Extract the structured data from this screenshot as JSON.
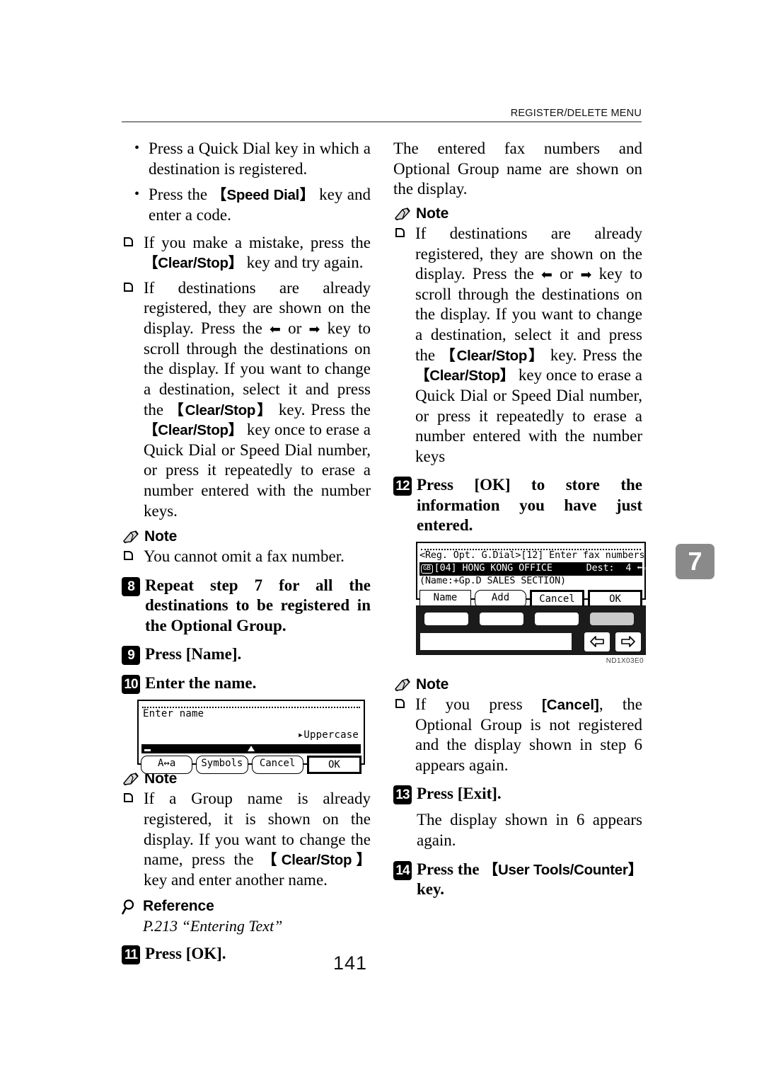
{
  "header": {
    "running_head": "REGISTER/DELETE MENU"
  },
  "left_column": {
    "bullets": [
      "Press a Quick Dial key in which a destination is regis-tered.",
      "Press the "
    ],
    "bullet1": "Press a Quick Dial key in which a destination is registered.",
    "bullet2_pre": "Press the ",
    "bullet2_key": "【Speed Dial】",
    "bullet2_post": " key and enter a code.",
    "note_a_pre": "If you make a mistake, press the ",
    "note_a_key": "【Clear/Stop】",
    "note_a_post": " key and try again.",
    "note_b_1": "If destinations are already registered, they are shown on the display. Press the ",
    "note_b_arrow_left": "⬅",
    "note_b_or": " or ",
    "note_b_arrow_right": "➡",
    "note_b_2": " key to scroll through the destinations on the display. If you want to change a destination, select it and press the ",
    "note_b_key1": "【Clear/Stop】",
    "note_b_3": " key. Press the ",
    "note_b_key2": "【Clear/Stop】",
    "note_b_4": " key once to erase a Quick Dial or Speed Dial number, or press it repeatedly to erase a number entered with the number keys.",
    "note_heading": "Note",
    "note_c": "You cannot omit a fax number.",
    "step8_num": "8",
    "step8_text": "Repeat step 7 for all the destinations to be registered in the Optional Group.",
    "step9_num": "9",
    "step9_text": "Press [Name].",
    "step10_num": "10",
    "step10_text": "Enter the name.",
    "lcd_enter_name": {
      "title": "Enter name",
      "case_mode": "▸Uppercase",
      "buttons": [
        "A↔a",
        "Symbols",
        "Cancel",
        "OK"
      ]
    },
    "note2_heading": "Note",
    "note2_1": "If a Group name is already registered, it is shown on the display. If you want to change the name, press the ",
    "note2_key": "【Clear/Stop】",
    "note2_2": " key and enter another name.",
    "reference_heading": "Reference",
    "reference_text": "P.213 “Entering Text”",
    "step11_num": "11",
    "step11_text": "Press [OK]."
  },
  "right_column": {
    "intro": "The entered fax numbers and Optional Group name are shown on the display.",
    "note_heading": "Note",
    "note_1": "If destinations are already registered, they are shown on the display. Press the ",
    "arrow_left": "⬅",
    "or_word": " or ",
    "arrow_right": "➡",
    "note_2": " key to scroll through the destinations on the display. If you want to change a destination, select it and press the ",
    "note_key1": "【Clear/",
    "note_key1b": "Stop】",
    "note_3": " key. Press the ",
    "note_key2": "【Clear/Stop】",
    "note_4": " key once to erase a Quick Dial or Speed Dial number, or press it repeatedly to erase a number entered with the number keys",
    "step12_num": "12",
    "step12_text": "Press [OK] to store the information you have just entered.",
    "lcd_reg_opt": {
      "line1": "<Reg. Opt. G.Dial>[12] Enter fax numbers",
      "line2_icon": "GB",
      "line2": "[04] HONG KONG OFFICE      Dest:  4 ",
      "line2_nav_left": "⬅",
      "line2_nav_right": "⇨",
      "line3": "(Name:+Gp.D SALES SECTION)",
      "buttons": [
        "Name",
        "Add",
        "Cancel",
        "OK"
      ]
    },
    "panel_caption": "ND1X03E0",
    "note2_heading": "Note",
    "note2_pre": "If you press ",
    "note2_key": "[Cancel]",
    "note2_post": ", the Optional Group is not registered and the display shown in step 6 appears again.",
    "step13_num": "13",
    "step13_text": "Press [Exit].",
    "step13_body": "The display shown in 6 appears again.",
    "step14_num": "14",
    "step14_pre": "Press the ",
    "step14_key": "【User Tools/Counter】",
    "step14_post": " key."
  },
  "chapter_tab": "7",
  "folio": "141",
  "colors": {
    "rule": "#8a8a8a",
    "tab_bg": "#8a8a8a",
    "text": "#000000"
  }
}
